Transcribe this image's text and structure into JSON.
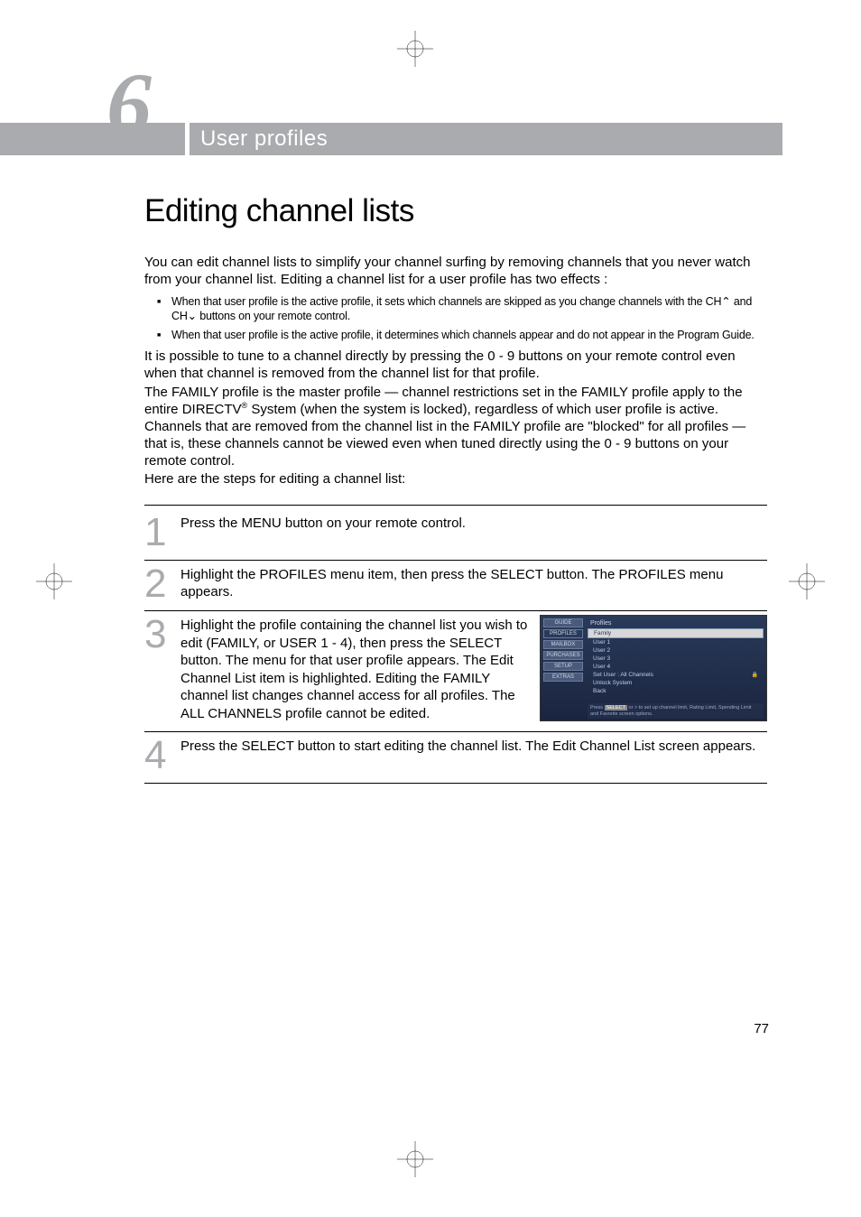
{
  "chapter_number": "6",
  "chapter_title": "User profiles",
  "page_number": "77",
  "heading": "Editing channel lists",
  "intro_para": "You can edit channel lists to simplify your channel surfing by removing channels that you never watch from your channel list. Editing a channel list for a user profile has two effects :",
  "bullets": [
    "When that user profile is the active profile, it sets which channels are skipped as you change channels with the CH⌃ and CH⌄ buttons on your remote control.",
    "When that user profile is the active profile, it determines which channels appear and do not appear in the Program Guide."
  ],
  "para2": "It is possible to tune to a channel directly by pressing the 0 - 9 buttons on your remote control even when that channel is removed from the channel list for that profile.",
  "para3_prefix": "The FAMILY profile is the master profile — channel restrictions set in the FAMILY profile apply to the entire DIRECTV",
  "para3_suffix": " System (when the system is locked), regardless of which user profile is active. Channels that are removed from the channel list in the FAMILY profile are \"blocked\" for all profiles — that is, these channels cannot be viewed even when tuned directly using the 0 - 9 buttons on your remote control.",
  "para4": "Here are the steps for editing a channel list:",
  "steps": [
    {
      "num": "1",
      "text": "Press the MENU button on your remote control."
    },
    {
      "num": "2",
      "text": "Highlight the PROFILES menu item, then press the SELECT button. The PROFILES menu appears."
    },
    {
      "num": "3",
      "text": "Highlight the profile containing the channel list you wish to edit (FAMILY, or USER 1 - 4), then press the SELECT button. The menu for that user profile appears. The Edit Channel List item is highlighted. Editing the FAMILY channel list changes channel access for all profiles. The ALL CHANNELS profile cannot be edited."
    },
    {
      "num": "4",
      "text": "Press the SELECT button to start editing the channel list. The Edit Channel List screen appears."
    }
  ],
  "screenshot": {
    "tabs": [
      "GUIDE",
      "PROFILES",
      "MAILBOX",
      "PURCHASES",
      "SETUP",
      "EXTRAS"
    ],
    "header": "Profiles",
    "rows": [
      "Family",
      "User 1",
      "User 2",
      "User 3",
      "User 4",
      "Set User : All Channels",
      "Unlock System",
      "Back"
    ],
    "selected_row": "Family",
    "locked_row": "Set User : All Channels",
    "footer_prefix": "Press ",
    "footer_button": "SELECT",
    "footer_suffix": " or > to set up channel limit, Rating Limit, Spending Limit and Favorite screen options."
  }
}
